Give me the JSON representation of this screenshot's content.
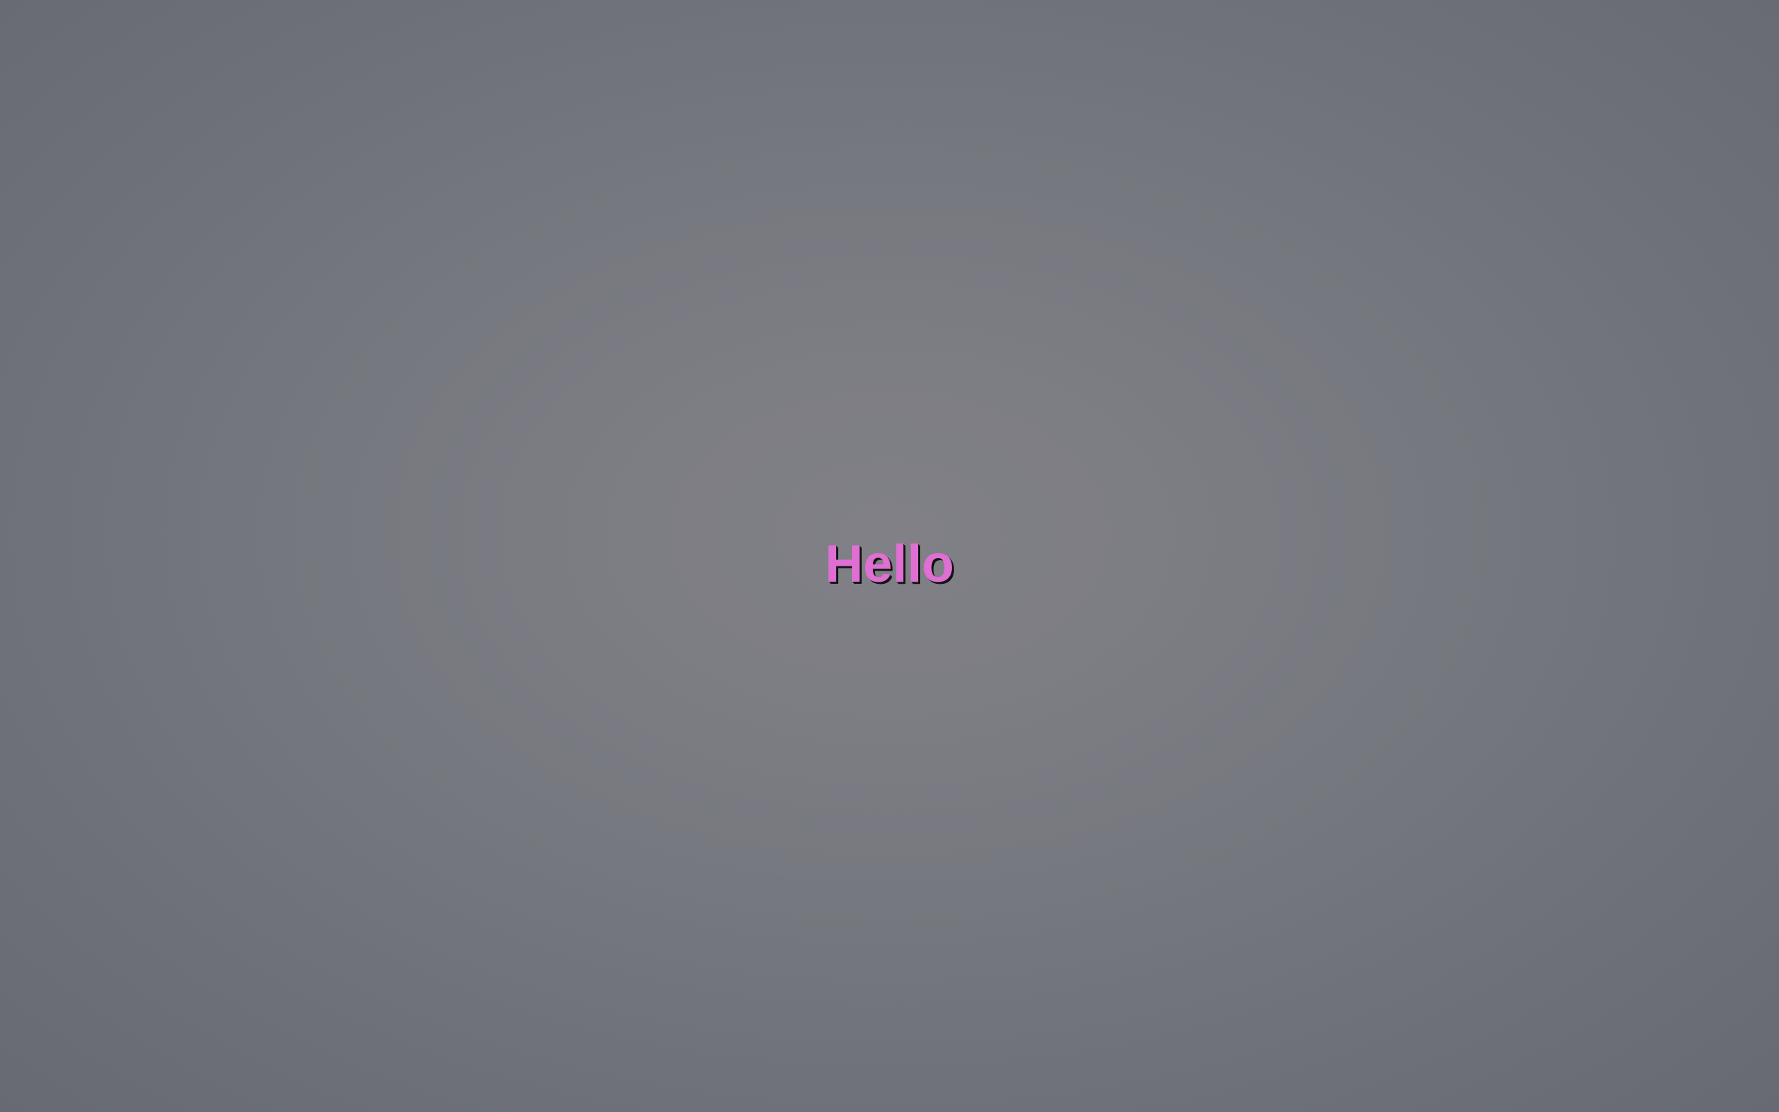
{
  "greeting": {
    "text": "Hello",
    "color": "#df6fd2"
  },
  "background": {
    "center_color": "#808086",
    "edge_color": "#676a73"
  }
}
